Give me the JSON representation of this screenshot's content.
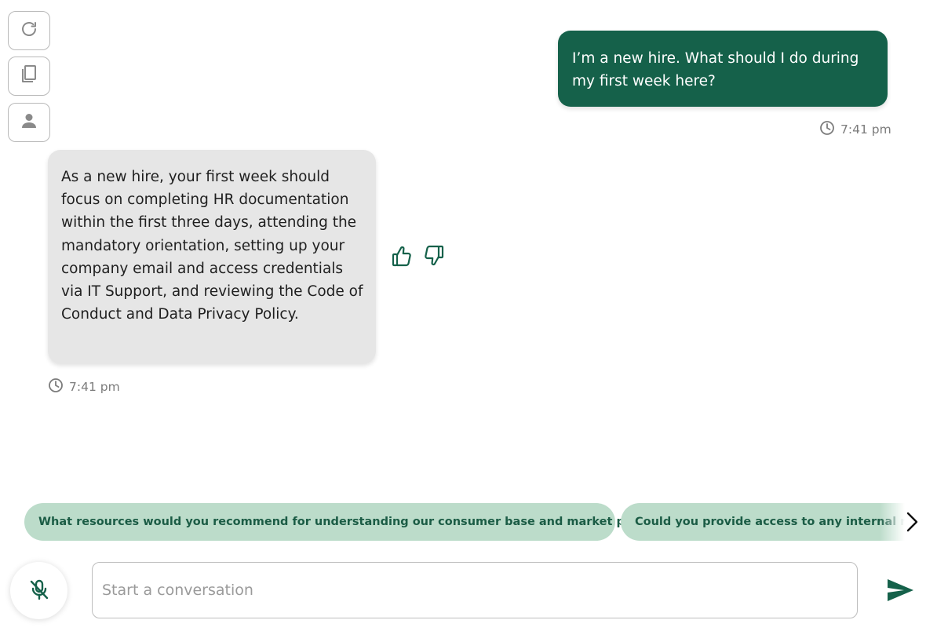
{
  "toolbar": {
    "buttons": [
      {
        "icon": "refresh-icon"
      },
      {
        "icon": "copy-icon"
      },
      {
        "icon": "user-icon"
      }
    ]
  },
  "messages": [
    {
      "role": "user",
      "text": "I’m a new hire. What should I do during my first week here?",
      "time": "7:41 pm"
    },
    {
      "role": "assistant",
      "text": "As a new hire, your first week should focus on completing HR documentation within the first three days, attending the mandatory orientation, setting up your company email and access credentials via IT Support, and reviewing the Code of Conduct and Data Privacy Policy.",
      "time": "7:41 pm"
    }
  ],
  "suggestions": [
    "What resources would you recommend for understanding our consumer base and market position?",
    "Could you provide access to any internal reports"
  ],
  "composer": {
    "placeholder": "Start a conversation",
    "value": ""
  },
  "colors": {
    "brand": "#15614a",
    "chip_bg": "#bcdcca",
    "bot_bubble": "#e6e6e6"
  }
}
